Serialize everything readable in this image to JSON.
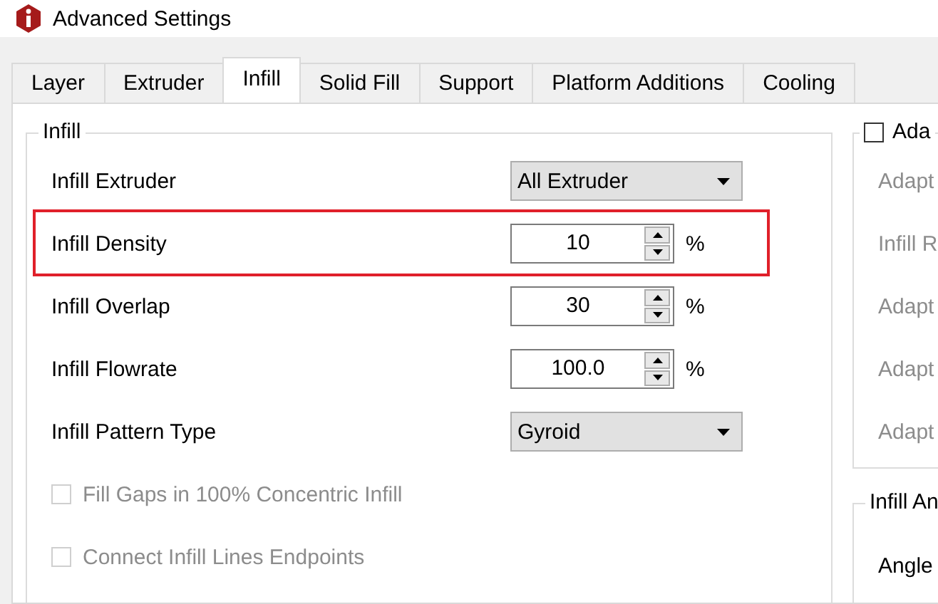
{
  "window": {
    "title": "Advanced Settings"
  },
  "tabs": [
    {
      "label": "Layer",
      "selected": false
    },
    {
      "label": "Extruder",
      "selected": false
    },
    {
      "label": "Infill",
      "selected": true
    },
    {
      "label": "Solid Fill",
      "selected": false
    },
    {
      "label": "Support",
      "selected": false
    },
    {
      "label": "Platform Additions",
      "selected": false
    },
    {
      "label": "Cooling",
      "selected": false
    }
  ],
  "infill_group": {
    "title": "Infill",
    "settings": [
      {
        "kind": "dropdown",
        "label": "Infill Extruder",
        "value": "All Extruder",
        "highlighted": false
      },
      {
        "kind": "spinbox",
        "label": "Infill Density",
        "value": "10",
        "unit": "%",
        "highlighted": true
      },
      {
        "kind": "spinbox",
        "label": "Infill Overlap",
        "value": "30",
        "unit": "%",
        "highlighted": false
      },
      {
        "kind": "spinbox",
        "label": "Infill Flowrate",
        "value": "100.0",
        "unit": "%",
        "highlighted": false
      },
      {
        "kind": "dropdown",
        "label": "Infill Pattern Type",
        "value": "Gyroid",
        "highlighted": false
      },
      {
        "kind": "checkbox",
        "label": "Fill Gaps in 100% Concentric Infill",
        "checked": false,
        "disabled": true
      },
      {
        "kind": "checkbox",
        "label": "Connect Infill Lines Endpoints",
        "checked": false,
        "disabled": true
      }
    ]
  },
  "adaptive_group": {
    "title": "Ada",
    "checked": false,
    "settings": [
      {
        "label": "Adapt",
        "disabled": true
      },
      {
        "label": "Infill R",
        "disabled": true
      },
      {
        "label": "Adapt",
        "disabled": true
      },
      {
        "label": "Adapt",
        "disabled": true
      },
      {
        "label": "Adapt",
        "disabled": true
      }
    ]
  },
  "infill_angle_group": {
    "title": "Infill An",
    "settings": [
      {
        "label": "Angle",
        "disabled": false
      }
    ]
  }
}
